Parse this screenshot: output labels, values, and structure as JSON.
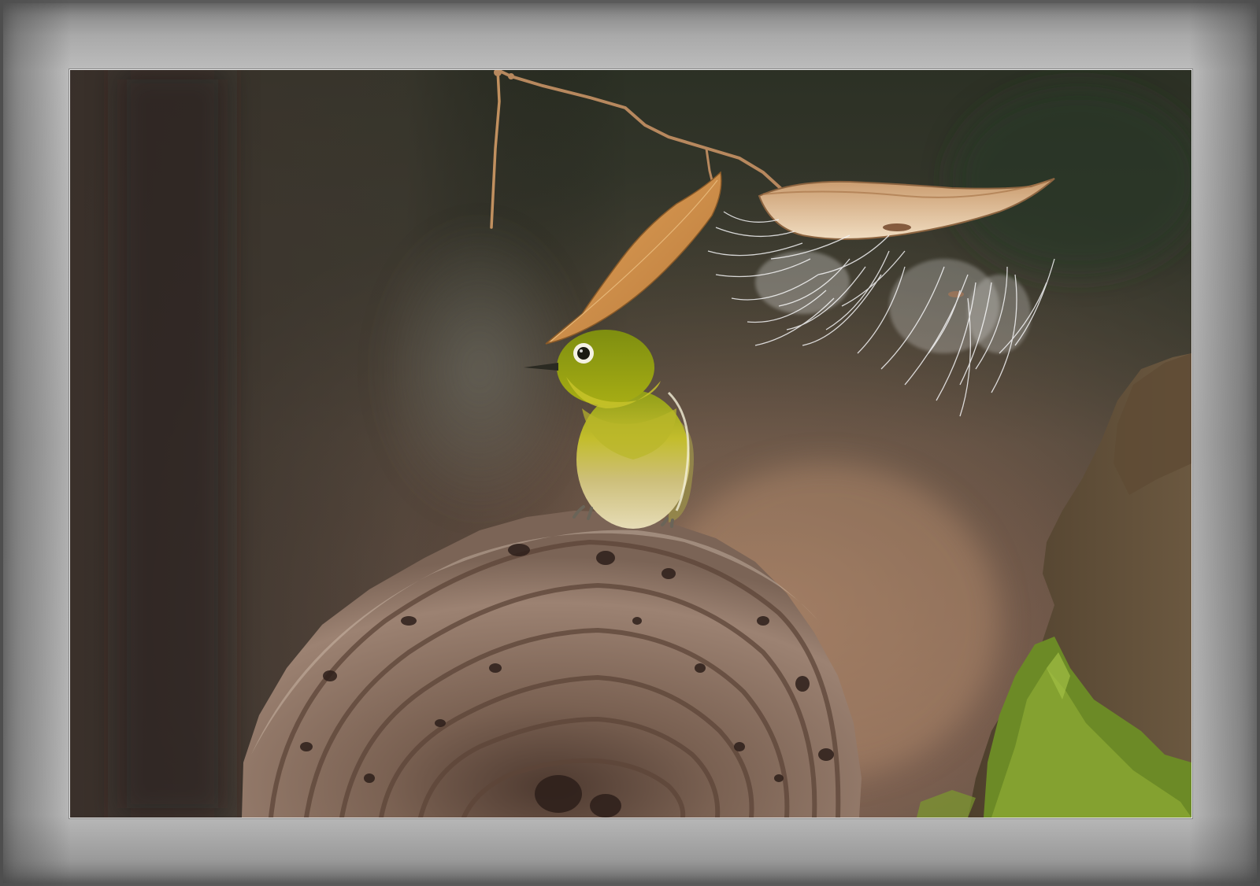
{
  "scene": {
    "subject": "",
    "colors": {
      "frame": "#b3b3b3",
      "background_dark": "#2f3226",
      "background_warm": "#8a6a55",
      "bird_green": "#a2a218",
      "bird_belly": "#d8c89a",
      "fungus": "#8f7566",
      "leaf": "#d39a52",
      "moss": "#6f8a2a"
    }
  }
}
